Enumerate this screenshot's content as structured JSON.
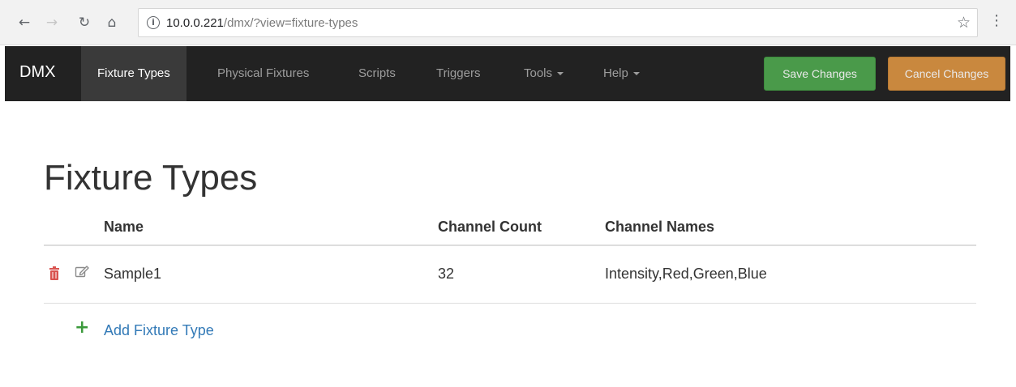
{
  "browser": {
    "url_host": "10.0.0.221",
    "url_path": "/dmx/?view=fixture-types"
  },
  "navbar": {
    "brand": "DMX",
    "items": [
      {
        "label": "Fixture Types",
        "active": true
      },
      {
        "label": "Physical Fixtures"
      },
      {
        "label": "Scripts"
      },
      {
        "label": "Triggers"
      },
      {
        "label": "Tools",
        "dropdown": true
      },
      {
        "label": "Help",
        "dropdown": true
      }
    ],
    "save_label": "Save Changes",
    "cancel_label": "Cancel Changes"
  },
  "page": {
    "title": "Fixture Types"
  },
  "table": {
    "headers": [
      "Name",
      "Channel Count",
      "Channel Names"
    ],
    "rows": [
      {
        "name": "Sample1",
        "channel_count": "32",
        "channel_names": "Intensity,Red,Green,Blue"
      }
    ]
  },
  "actions": {
    "add_label": "Add Fixture Type"
  },
  "colors": {
    "navbar_bg": "#222222",
    "save_btn": "#4a9a4a",
    "cancel_btn": "#c9883e",
    "link": "#337ab7",
    "delete_icon": "#d9534f",
    "add_icon": "#3c9a3c"
  }
}
